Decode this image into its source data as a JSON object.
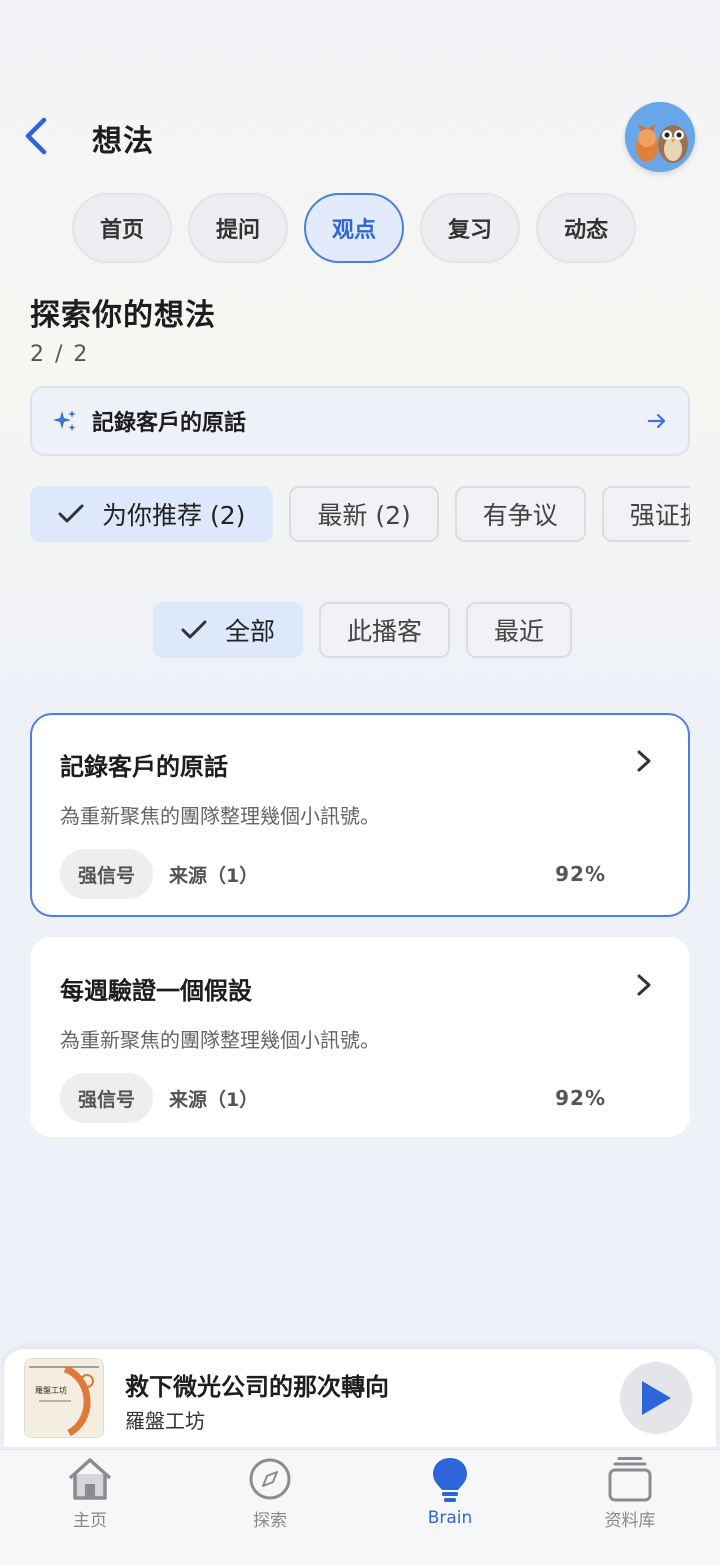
{
  "header": {
    "title": "想法"
  },
  "tabs": [
    {
      "label": "首页"
    },
    {
      "label": "提问"
    },
    {
      "label": "观点",
      "active": true
    },
    {
      "label": "复习"
    },
    {
      "label": "动态"
    }
  ],
  "section": {
    "title": "探索你的想法",
    "page_count": "2 / 2"
  },
  "suggestion": {
    "label": "記錄客戶的原話"
  },
  "filters": [
    {
      "label": "为你推荐 (2)",
      "active": true
    },
    {
      "label": "最新 (2)"
    },
    {
      "label": "有争议"
    },
    {
      "label": "强证据"
    }
  ],
  "scopes": [
    {
      "label": "全部",
      "active": true
    },
    {
      "label": "此播客"
    },
    {
      "label": "最近"
    }
  ],
  "cards": [
    {
      "title": "記錄客戶的原話",
      "desc": "為重新聚焦的團隊整理幾個小訊號。",
      "strength": "强信号",
      "source": "来源（1）",
      "score": "92%",
      "selected": true
    },
    {
      "title": "每週驗證一個假設",
      "desc": "為重新聚焦的團隊整理幾個小訊號。",
      "strength": "强信号",
      "source": "来源（1）",
      "score": "92%"
    }
  ],
  "player": {
    "title": "救下微光公司的那次轉向",
    "subtitle": "羅盤工坊",
    "cover_text": "羅盤工坊"
  },
  "nav": [
    {
      "label": "主页",
      "icon": "home-icon"
    },
    {
      "label": "探索",
      "icon": "compass-icon"
    },
    {
      "label": "Brain",
      "icon": "lightbulb-icon",
      "active": true
    },
    {
      "label": "资料库",
      "icon": "library-icon"
    }
  ],
  "colors": {
    "accent": "#2e66d9",
    "selected_border": "#4b7fe0"
  }
}
